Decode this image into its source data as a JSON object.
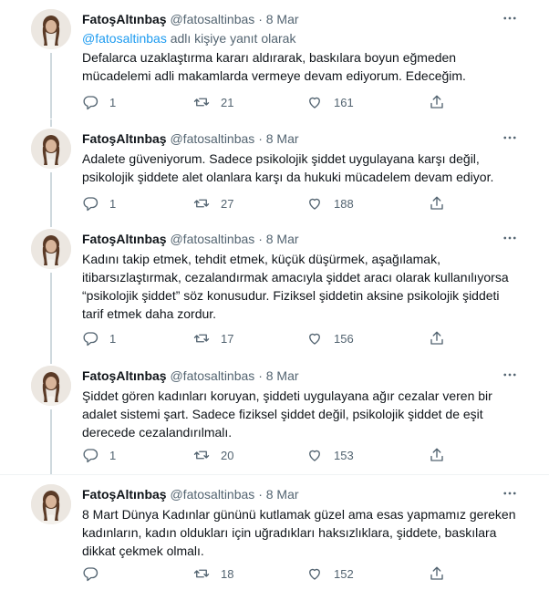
{
  "tweets": [
    {
      "name": "FatoşAltınbaş",
      "handle": "@fatosaltinbas",
      "dot": "·",
      "date": "8 Mar",
      "reply_mention": "@fatosaltinbas",
      "reply_suffix": "adlı kişiye yanıt olarak",
      "lines": [
        "Defalarca uzaklaştırma kararı aldırarak, baskılara boyun eğmeden",
        "mücadelemi adli makamlarda vermeye devam ediyorum. Edeceğim."
      ],
      "replies": "1",
      "retweets": "21",
      "likes": "161"
    },
    {
      "name": "FatoşAltınbaş",
      "handle": "@fatosaltinbas",
      "dot": "·",
      "date": "8 Mar",
      "lines": [
        "Adalete güveniyorum. Sadece psikolojik şiddet uygulayana karşı değil,",
        "psikolojik şiddete alet olanlara karşı da hukuki mücadelem devam ediyor."
      ],
      "replies": "1",
      "retweets": "27",
      "likes": "188"
    },
    {
      "name": "FatoşAltınbaş",
      "handle": "@fatosaltinbas",
      "dot": "·",
      "date": "8 Mar",
      "lines": [
        "Kadını takip etmek, tehdit etmek, küçük düşürmek, aşağılamak,",
        "itibarsızlaştırmak, cezalandırmak amacıyla şiddet aracı olarak kullanılıyorsa",
        "“psikolojik şiddet” söz konusudur. Fiziksel şiddetin aksine psikolojik şiddeti",
        "tarif etmek daha zordur."
      ],
      "replies": "1",
      "retweets": "17",
      "likes": "156"
    },
    {
      "name": "FatoşAltınbaş",
      "handle": "@fatosaltinbas",
      "dot": "·",
      "date": "8 Mar",
      "lines": [
        "Şiddet gören kadınları koruyan, şiddeti uygulayana ağır cezalar veren bir",
        "adalet sistemi şart. Sadece fiziksel şiddet değil, psikolojik şiddet de eşit",
        "derecede cezalandırılmalı."
      ],
      "replies": "1",
      "retweets": "20",
      "likes": "153"
    },
    {
      "name": "FatoşAltınbaş",
      "handle": "@fatosaltinbas",
      "dot": "·",
      "date": "8 Mar",
      "lines": [
        "8 Mart Dünya Kadınlar gününü kutlamak güzel ama esas yapmamız gereken",
        "kadınların, kadın oldukları için uğradıkları haksızlıklara, şiddete, baskılara",
        "dikkat çekmek olmalı."
      ],
      "replies": "",
      "retweets": "18",
      "likes": "152"
    }
  ],
  "icons": {
    "more": "more-horizontal-icon",
    "reply": "reply-icon",
    "retweet": "retweet-icon",
    "like": "heart-icon",
    "share": "share-icon"
  },
  "colors": {
    "text": "#0f1419",
    "secondary": "#536471",
    "link": "#1d9bf0",
    "thread_line": "#cfd9de",
    "divider": "#eff3f4"
  }
}
